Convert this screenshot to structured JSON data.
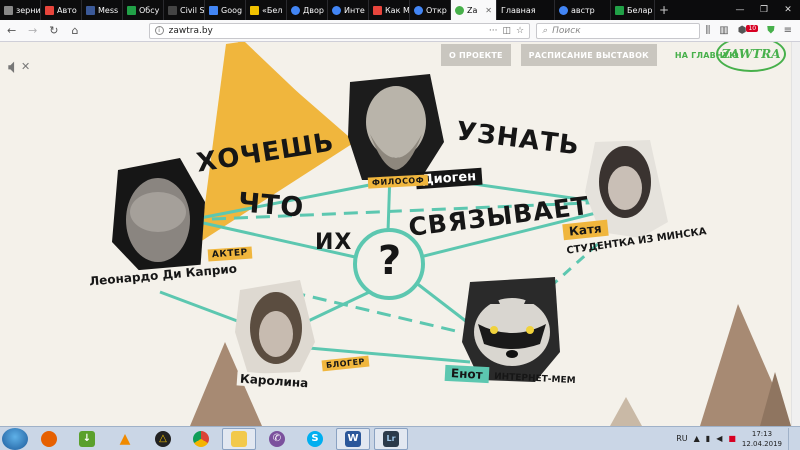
{
  "browser": {
    "tabs": [
      {
        "label": "зерни",
        "color": "#888888"
      },
      {
        "label": "Авто",
        "color": "#e8453c"
      },
      {
        "label": "Mess",
        "color": "#3b5998"
      },
      {
        "label": "Обсу",
        "color": "#21a047"
      },
      {
        "label": "Civil S",
        "color": "#222222"
      },
      {
        "label": "Goog",
        "color": "#4285f4"
      },
      {
        "label": "«Бел",
        "color": "#f2c200"
      },
      {
        "label": "Двор",
        "color": "#4285f4"
      },
      {
        "label": "Инте",
        "color": "#4285f4"
      },
      {
        "label": "Как М",
        "color": "#e8453c"
      },
      {
        "label": "Откр",
        "color": "#4285f4"
      },
      {
        "label": "Za",
        "color": "#47b04b",
        "active": true
      },
      {
        "label": "Главная",
        "color": "#e1e1e1"
      },
      {
        "label": "австр",
        "color": "#4285f4"
      },
      {
        "label": "Белар",
        "color": "#21a047"
      }
    ],
    "url": "zawtra.by",
    "search_placeholder": "Поиск"
  },
  "page": {
    "menu": {
      "about": "О ПРОЕКТЕ",
      "schedule": "РАСПИСАНИЕ ВЫСТАВОК",
      "home": "НА ГЛАВНУЮ"
    },
    "logo": "ZAWTRA",
    "headline": {
      "w1": "ХОЧЕШЬ",
      "w2": "УЗНАТЬ",
      "w3": "ЧТО",
      "w4": "ИХ",
      "w5": "СВЯЗЫВАЕТ",
      "question": "?"
    },
    "people": {
      "diogen": {
        "name": "Диоген",
        "role": "ФИЛОСОФ"
      },
      "katya": {
        "name": "Катя",
        "role": "студентка из Минска"
      },
      "leo": {
        "name": "Леонардо Ди Каприо",
        "role": "АКТЕР"
      },
      "karolina": {
        "name": "Каролина",
        "role": "БЛОГЕР"
      },
      "enot": {
        "name": "Енот",
        "role": "интернет-мем"
      }
    }
  },
  "taskbar": {
    "lang": "RU",
    "time": "17:13",
    "date": "12.04.2019"
  },
  "colors": {
    "accent_green": "#47b04b",
    "line_teal": "#5cc7b0",
    "triangle_yellow": "#f0b63d",
    "mountain_brown": "#a78a73"
  }
}
